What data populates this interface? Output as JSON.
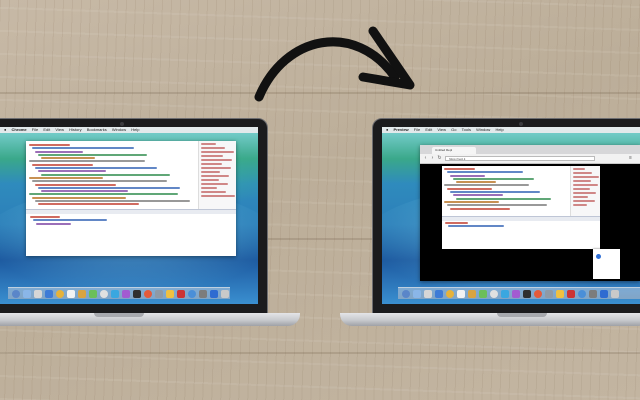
{
  "scene": {
    "transition": "arrow-left-to-right"
  },
  "left_laptop": {
    "menubar": {
      "app": "Chrome",
      "items": [
        "File",
        "Edit",
        "View",
        "History",
        "Bookmarks",
        "Window",
        "Help"
      ]
    }
  },
  "right_laptop": {
    "menubar": {
      "app": "Preview",
      "items": [
        "File",
        "Edit",
        "View",
        "Go",
        "Tools",
        "Window",
        "Help"
      ]
    },
    "browser": {
      "tab_title": "Untitled Repl",
      "address": "https://repl.it"
    }
  },
  "colors": {
    "code_palette": [
      "#c0392b",
      "#2e5fb3",
      "#7a3fa0",
      "#2b8a4a",
      "#b46c1a",
      "#777777"
    ],
    "dock_palette": [
      "#5a86c9",
      "#8ab6e8",
      "#d6d6d6",
      "#3e7bd6",
      "#e6b23a",
      "#f2f2f2",
      "#d9a441",
      "#6bbf59",
      "#e0e0e0",
      "#3aa7e0",
      "#a35bd1",
      "#2f2f2f",
      "#e45a3a",
      "#8f9aa6",
      "#f0c040",
      "#cc3333",
      "#4a8fd8",
      "#7c7c7c",
      "#2e6bd1",
      "#c9c9c9"
    ]
  }
}
